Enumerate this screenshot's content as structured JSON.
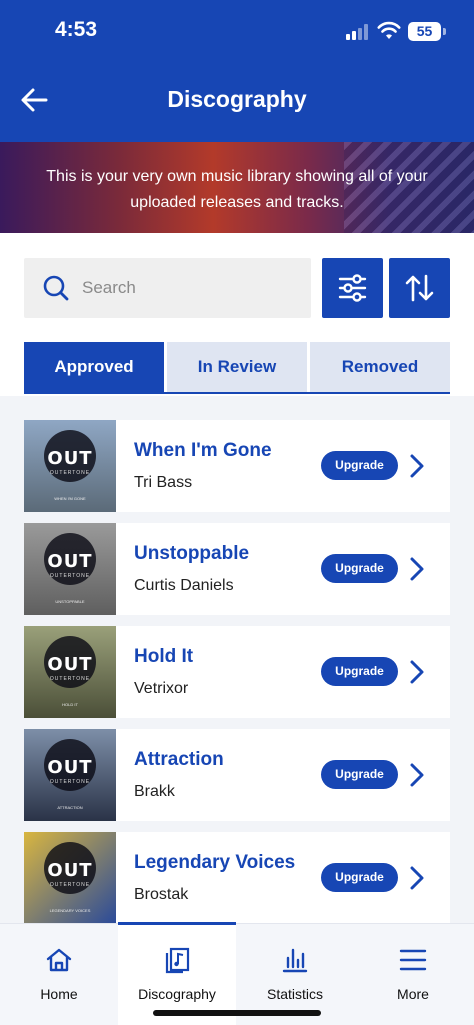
{
  "status_bar": {
    "time": "4:53",
    "battery": "55"
  },
  "header": {
    "title": "Discography",
    "back_icon": "arrow-left-icon"
  },
  "banner": {
    "text": "This is your very own music library showing all of your uploaded releases and tracks."
  },
  "search": {
    "placeholder": "Search",
    "value": ""
  },
  "tabs": [
    {
      "label": "Approved",
      "active": true
    },
    {
      "label": "In Review",
      "active": false
    },
    {
      "label": "Removed",
      "active": false
    }
  ],
  "releases": [
    {
      "title": "When I'm Gone",
      "artist": "Tri Bass",
      "action": "Upgrade",
      "art_logo": "OUT",
      "art_logo_sub": "OUTERTONE",
      "art_caption": "WHEN I'M GONE",
      "art_colors": [
        "#8fa7c4",
        "#5b6a78"
      ]
    },
    {
      "title": "Unstoppable",
      "artist": "Curtis Daniels",
      "action": "Upgrade",
      "art_logo": "OUT",
      "art_logo_sub": "OUTERTONE",
      "art_caption": "UNSTOPPABLE",
      "art_colors": [
        "#9a9a9a",
        "#5f5f5f"
      ]
    },
    {
      "title": "Hold It",
      "artist": "Vetrixor",
      "action": "Upgrade",
      "art_logo": "OUT",
      "art_logo_sub": "OUTERTONE",
      "art_caption": "HOLD IT",
      "art_colors": [
        "#9aa07a",
        "#4b4f38"
      ]
    },
    {
      "title": "Attraction",
      "artist": "Brakk",
      "action": "Upgrade",
      "art_logo": "OUT",
      "art_logo_sub": "OUTERTONE",
      "art_caption": "ATTRACTION",
      "art_colors": [
        "#7d8fa8",
        "#2a3347"
      ]
    },
    {
      "title": "Legendary Voices",
      "artist": "Brostak",
      "action": "Upgrade",
      "art_logo": "OUT",
      "art_logo_sub": "OUTERTONE",
      "art_caption": "LEGENDARY VOICES",
      "art_colors": [
        "#d9b640",
        "#2a4a9a"
      ]
    }
  ],
  "bottom_nav": [
    {
      "label": "Home",
      "icon": "home-icon",
      "active": false
    },
    {
      "label": "Discography",
      "icon": "discography-icon",
      "active": true
    },
    {
      "label": "Statistics",
      "icon": "statistics-icon",
      "active": false
    },
    {
      "label": "More",
      "icon": "menu-icon",
      "active": false
    }
  ],
  "colors": {
    "brand": "#1746b4",
    "tab_inactive_bg": "#dfe5f2",
    "list_bg": "#f2f4f8"
  }
}
